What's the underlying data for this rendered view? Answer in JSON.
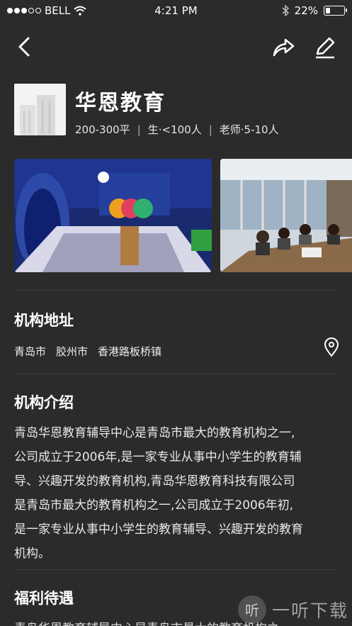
{
  "status_bar": {
    "carrier": "BELL",
    "time": "4:21 PM",
    "battery_percent": "22%",
    "battery_level": 0.22,
    "signal_dots_filled": 3,
    "signal_dots_total": 5
  },
  "nav": {
    "back_icon": "chevron-left",
    "share_icon": "share-arrow",
    "edit_icon": "pencil"
  },
  "org": {
    "name": "华恩教育",
    "meta": {
      "area": "200-300平",
      "students": "生·<100人",
      "teachers": "老师·5-10人",
      "separator": "|"
    }
  },
  "gallery": {
    "photos": [
      {
        "label": "classroom-blue-interior"
      },
      {
        "label": "meeting-room"
      }
    ]
  },
  "address_section": {
    "title": "机构地址",
    "city": "青岛市",
    "district": "胶州市",
    "street": "香港路板桥镇"
  },
  "intro_section": {
    "title": "机构介绍",
    "lines": [
      "青岛华恩教育辅导中心是青岛市最大的教育机构之一,",
      "公司成立于2006年,是一家专业从事中小学生的教育辅",
      "导、兴趣开发的教育机构,青岛华恩教育科技有限公司",
      "是青岛市最大的教育机构之一,公司成立于2006年初,",
      "是一家专业从事中小学生的教育辅导、兴趣开发的教育",
      "机构。"
    ]
  },
  "benefits_section": {
    "title": "福利待遇",
    "partial_text": "青岛华恩教育辅导中心是青岛市最大的教育机构之"
  },
  "watermark": {
    "icon_char": "听",
    "text": "一听下载"
  },
  "colors": {
    "background": "#2b2b2b",
    "divider": "#3d3d3d",
    "text": "#ffffff"
  }
}
